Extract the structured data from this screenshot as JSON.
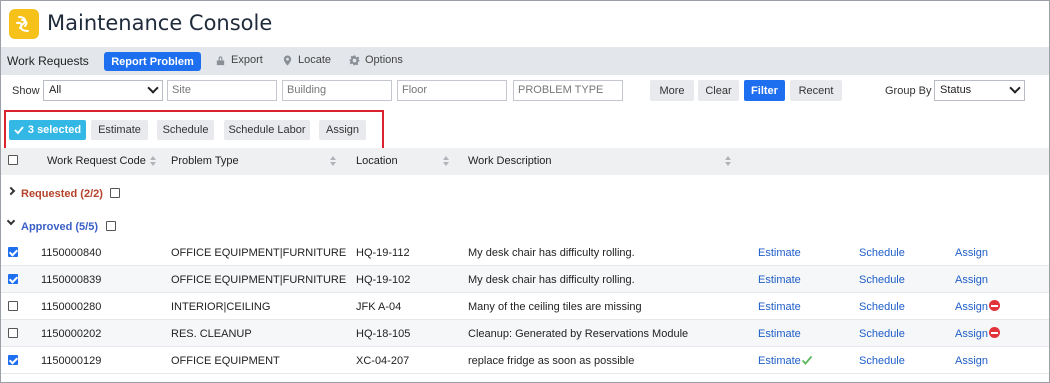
{
  "app": {
    "title": "Maintenance Console"
  },
  "toolbar": {
    "label": "Work Requests",
    "report_problem": "Report Problem",
    "export": "Export",
    "locate": "Locate",
    "options": "Options"
  },
  "filters": {
    "show_label": "Show",
    "show_value": "All",
    "site_placeholder": "Site",
    "building_placeholder": "Building",
    "floor_placeholder": "Floor",
    "problem_type_placeholder": "PROBLEM TYPE",
    "more": "More",
    "clear": "Clear",
    "filter": "Filter",
    "recent": "Recent",
    "group_by_label": "Group By",
    "group_by_value": "Status"
  },
  "selection": {
    "badge": "3 selected",
    "estimate": "Estimate",
    "schedule": "Schedule",
    "schedule_labor": "Schedule Labor",
    "assign": "Assign"
  },
  "columns": {
    "code": "Work Request Code",
    "problem_type": "Problem Type",
    "location": "Location",
    "description": "Work Description"
  },
  "groups": {
    "requested": "Requested (2/2)",
    "approved": "Approved (5/5)"
  },
  "colors": {
    "requested": "#b5432a",
    "approved": "#3a5fc4",
    "accent": "#1e6ef0"
  },
  "rows": [
    {
      "checked": true,
      "code": "1150000840",
      "problem_type": "OFFICE EQUIPMENT|FURNITURE",
      "location": "HQ-19-112",
      "description": "My desk chair has difficulty rolling.",
      "estimate": "Estimate",
      "schedule": "Schedule",
      "assign": "Assign",
      "estimate_status": "",
      "assign_status": ""
    },
    {
      "checked": true,
      "code": "1150000839",
      "problem_type": "OFFICE EQUIPMENT|FURNITURE",
      "location": "HQ-19-102",
      "description": "My desk chair has difficulty rolling.",
      "estimate": "Estimate",
      "schedule": "Schedule",
      "assign": "Assign",
      "estimate_status": "",
      "assign_status": ""
    },
    {
      "checked": false,
      "code": "1150000280",
      "problem_type": "INTERIOR|CEILING",
      "location": "JFK A-04",
      "description": "Many of the ceiling tiles are missing",
      "estimate": "Estimate",
      "schedule": "Schedule",
      "assign": "Assign",
      "estimate_status": "",
      "assign_status": "blocked"
    },
    {
      "checked": false,
      "code": "1150000202",
      "problem_type": "RES. CLEANUP",
      "location": "HQ-18-105",
      "description": "Cleanup: Generated by Reservations Module",
      "estimate": "Estimate",
      "schedule": "Schedule",
      "assign": "Assign",
      "estimate_status": "",
      "assign_status": "blocked"
    },
    {
      "checked": true,
      "code": "1150000129",
      "problem_type": "OFFICE EQUIPMENT",
      "location": "XC-04-207",
      "description": "replace fridge as soon as possible",
      "estimate": "Estimate",
      "schedule": "Schedule",
      "assign": "Assign",
      "estimate_status": "done",
      "assign_status": ""
    }
  ]
}
